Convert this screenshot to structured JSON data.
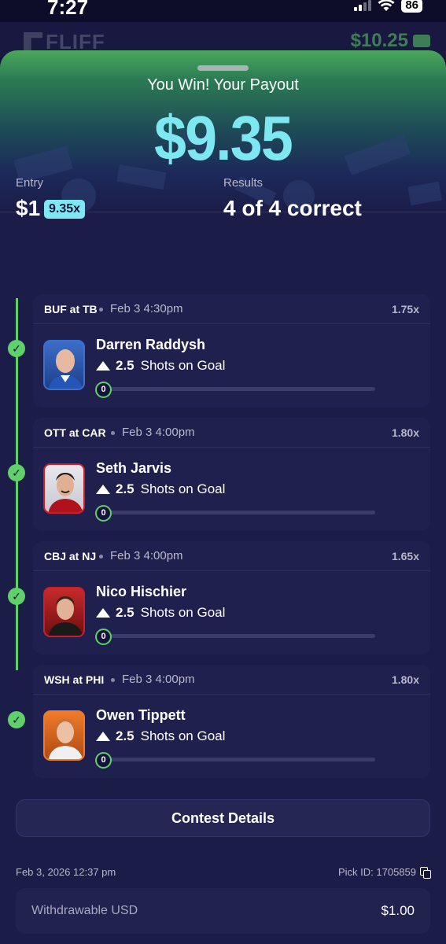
{
  "status_bar": {
    "time": "7:27",
    "battery": "86"
  },
  "app_header": {
    "brand": "FLIFF",
    "balance": "$10.25"
  },
  "hero": {
    "title": "You Win! Your Payout",
    "payout": "$9.35"
  },
  "summary": {
    "entry_label": "Entry",
    "entry_value": "$1",
    "multiplier": "9.35x",
    "results_label": "Results",
    "results_value": "4 of 4 correct"
  },
  "picks": [
    {
      "matchup": "BUF at TB",
      "time": "Feb 3 4:30pm",
      "multiplier": "1.75x",
      "player": "Darren Raddysh",
      "line": "2.5",
      "stat": "Shots on Goal",
      "actual": "0",
      "status": "correct"
    },
    {
      "matchup": "OTT at CAR",
      "time": "Feb 3 4:00pm",
      "multiplier": "1.80x",
      "player": "Seth Jarvis",
      "line": "2.5",
      "stat": "Shots on Goal",
      "actual": "0",
      "status": "correct"
    },
    {
      "matchup": "CBJ at NJ",
      "time": "Feb 3 4:00pm",
      "multiplier": "1.65x",
      "player": "Nico Hischier",
      "line": "2.5",
      "stat": "Shots on Goal",
      "actual": "0",
      "status": "correct"
    },
    {
      "matchup": "WSH at PHI",
      "time": "Feb 3 4:00pm",
      "multiplier": "1.80x",
      "player": "Owen Tippett",
      "line": "2.5",
      "stat": "Shots on Goal",
      "actual": "0",
      "status": "correct"
    }
  ],
  "contest_details_label": "Contest Details",
  "meta": {
    "date": "Feb 3, 2026  12:37 pm",
    "pick_id": "Pick ID: 1705859"
  },
  "withdrawable": {
    "label": "Withdrawable USD",
    "value": "$1.00"
  },
  "colors": {
    "accent": "#7ee8f2",
    "success": "#5fd06a",
    "background": "#14143a",
    "card": "#20204e"
  },
  "icons": [
    "wifi-icon",
    "signal-icon",
    "wallet-icon",
    "check-icon",
    "arrow-up-icon",
    "copy-icon"
  ]
}
